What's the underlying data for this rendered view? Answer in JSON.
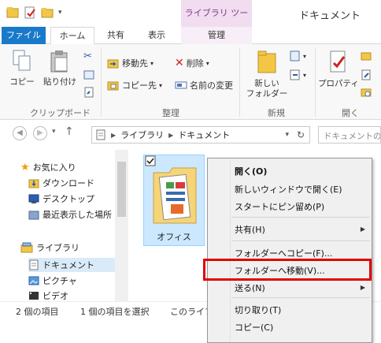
{
  "titlebar": {
    "context_tab_header": "ライブラリ ツール",
    "window_title": "ドキュメント"
  },
  "tabs": {
    "file": "ファイル",
    "home": "ホーム",
    "share": "共有",
    "view": "表示",
    "manage": "管理"
  },
  "ribbon": {
    "copy": "コピー",
    "paste": "貼り付け",
    "clipboard_group": "クリップボード",
    "move_to": "移動先",
    "copy_to": "コピー先",
    "delete": "削除",
    "rename": "名前の変更",
    "organize_group": "整理",
    "new_folder_line1": "新しい",
    "new_folder_line2": "フォルダー",
    "new_group": "新規",
    "properties": "プロパティ",
    "open_group": "開く"
  },
  "address": {
    "crumb_library": "ライブラリ",
    "crumb_documents": "ドキュメント",
    "search_placeholder": "ドキュメントの検"
  },
  "nav": {
    "favorites": "お気に入り",
    "downloads": "ダウンロード",
    "desktop": "デスクトップ",
    "recent": "最近表示した場所",
    "libraries": "ライブラリ",
    "documents": "ドキュメント",
    "pictures": "ピクチャ",
    "videos": "ビデオ"
  },
  "files": {
    "folder_name": "オフィス"
  },
  "status": {
    "count": "2 個の項目",
    "selected": "1 個の項目を選択",
    "library_info": "このライブ"
  },
  "context_menu": {
    "open": "開く(O)",
    "open_new_window": "新しいウィンドウで開く(E)",
    "pin_start": "スタートにピン留め(P)",
    "share": "共有(H)",
    "copy_to_folder": "フォルダーへコピー(F)...",
    "move_to_folder": "フォルダーへ移動(V)...",
    "send_to": "送る(N)",
    "cut": "切り取り(T)",
    "copy": "コピー(C)"
  },
  "colors": {
    "file_tab": "#1979ca",
    "selection": "#cce8ff",
    "highlight_box": "#e30000",
    "context_tab": "#f1dcf0"
  }
}
